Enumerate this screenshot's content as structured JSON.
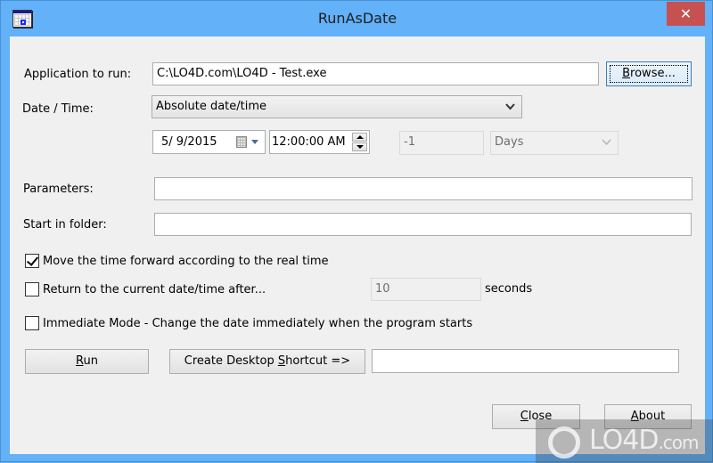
{
  "window": {
    "title": "RunAsDate",
    "app_icon": "calendar-icon",
    "close_icon": "close-icon",
    "close_glyph": "✕"
  },
  "form": {
    "app_label": "Application to run:",
    "app_value": "C:\\LO4D.com\\LO4D - Test.exe",
    "browse_label": "Browse...",
    "browse_access_key": "B",
    "browse_rest": "rowse...",
    "datetime_label": "Date / Time:",
    "datetime_mode": "Absolute date/time",
    "date_value": "5/  9/2015",
    "time_value": "12:00:00 AM",
    "relative_value": "-1",
    "relative_unit": "Days",
    "params_label": "Parameters:",
    "params_value": "",
    "start_folder_label": "Start in folder:",
    "start_folder_value": ""
  },
  "options": {
    "move_forward": {
      "label": "Move the time forward according to the real time",
      "checked": true
    },
    "return_after": {
      "label": "Return to the current date/time after...",
      "checked": false
    },
    "return_seconds_value": "10",
    "return_seconds_unit": "seconds",
    "immediate_mode": {
      "label": "Immediate Mode - Change the date immediately when the program starts",
      "checked": false
    }
  },
  "actions": {
    "run_access_key": "R",
    "run_rest": "un",
    "shortcut_prefix": "Create Desktop ",
    "shortcut_access_key": "S",
    "shortcut_rest": "hortcut =>",
    "shortcut_name_value": "",
    "close_access_key": "C",
    "close_rest": "lose",
    "about_access_key": "A",
    "about_rest": "bout"
  },
  "watermark": {
    "text": "LO4D",
    "suffix": ".com"
  }
}
